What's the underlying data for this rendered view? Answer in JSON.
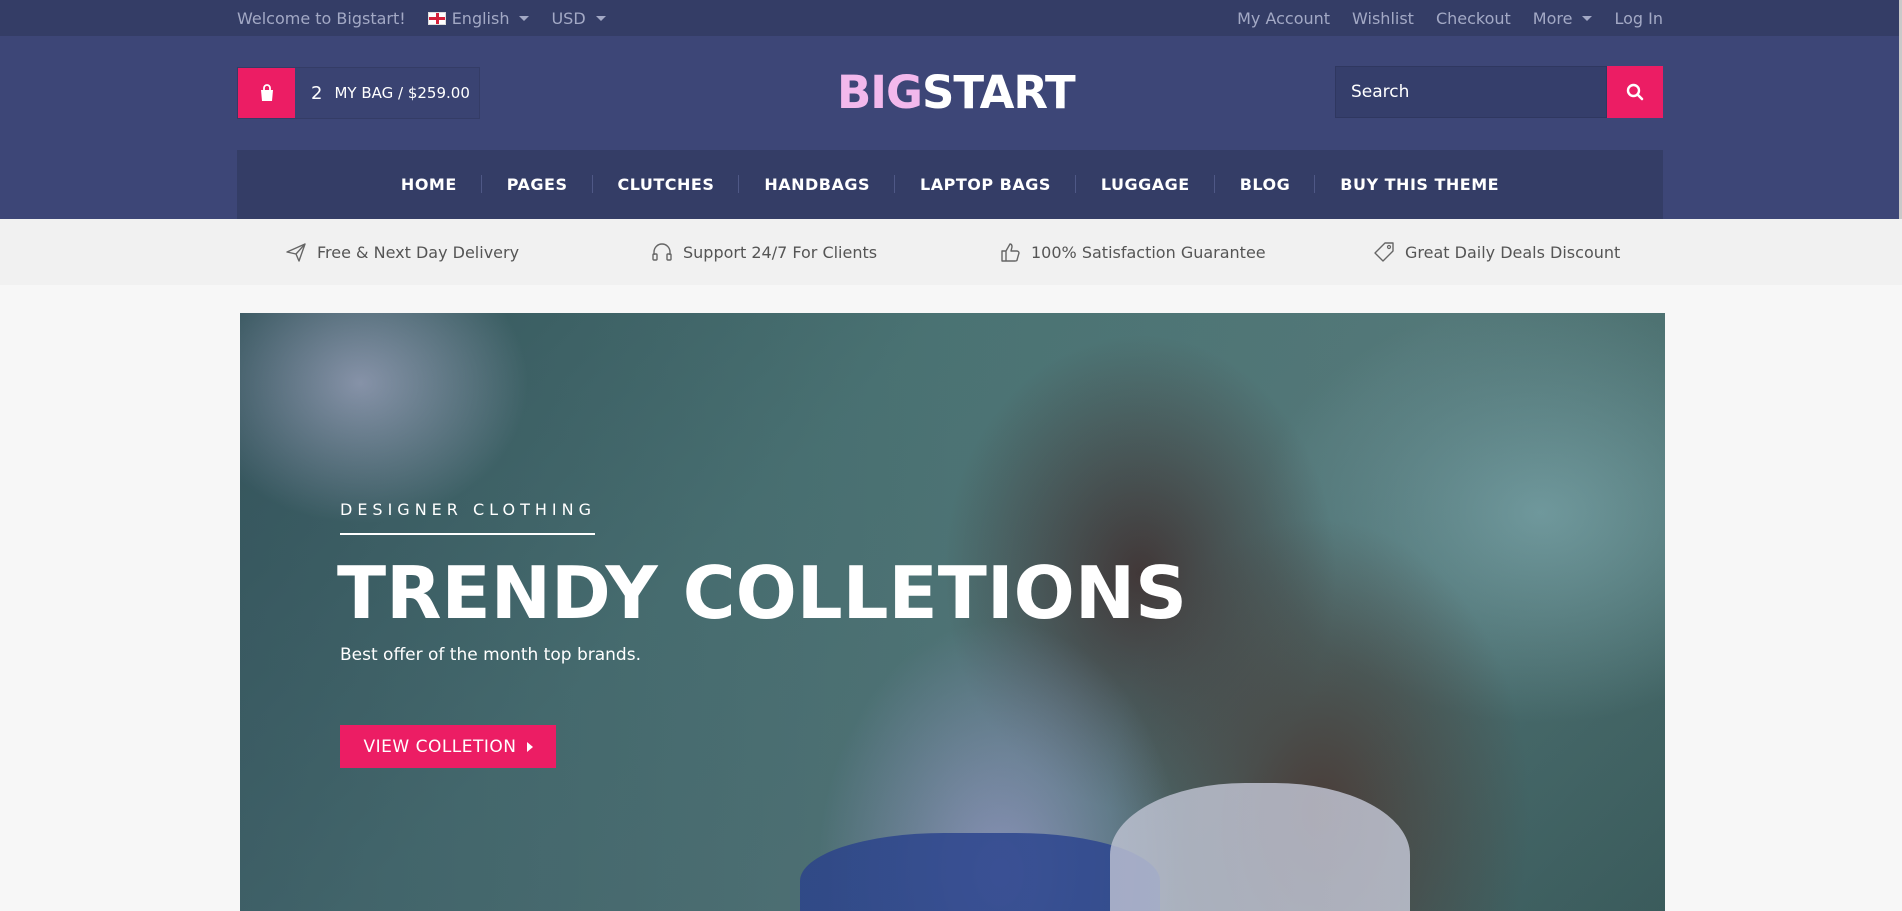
{
  "topbar": {
    "welcome": "Welcome to Bigstart!",
    "language": "English",
    "currency": "USD",
    "links": {
      "account": "My Account",
      "wishlist": "Wishlist",
      "checkout": "Checkout",
      "more": "More",
      "login": "Log In"
    }
  },
  "header": {
    "bag_count": "2",
    "bag_label": "MY BAG / $259.00",
    "logo_part1": "BIG",
    "logo_part2": "START",
    "search_placeholder": "Search"
  },
  "nav": [
    "HOME",
    "PAGES",
    "CLUTCHES",
    "HANDBAGS",
    "LAPTOP BAGS",
    "LUGGAGE",
    "BLOG",
    "BUY THIS THEME"
  ],
  "features": [
    {
      "label": "Free & Next Day Delivery",
      "icon": "plane-icon"
    },
    {
      "label": "Support 24/7 For Clients",
      "icon": "headphones-icon"
    },
    {
      "label": "100% Satisfaction Guarantee",
      "icon": "thumbs-up-icon"
    },
    {
      "label": "Great Daily Deals Discount",
      "icon": "tag-icon"
    }
  ],
  "hero": {
    "eyebrow": "DESIGNER CLOTHING",
    "title": "TRENDY COLLETIONS",
    "subtitle": "Best offer of the month top brands.",
    "button": "VIEW COLLETION"
  },
  "colors": {
    "accent": "#ec1d64",
    "header_bg": "#3d4677",
    "topbar_bg": "#343d66"
  }
}
